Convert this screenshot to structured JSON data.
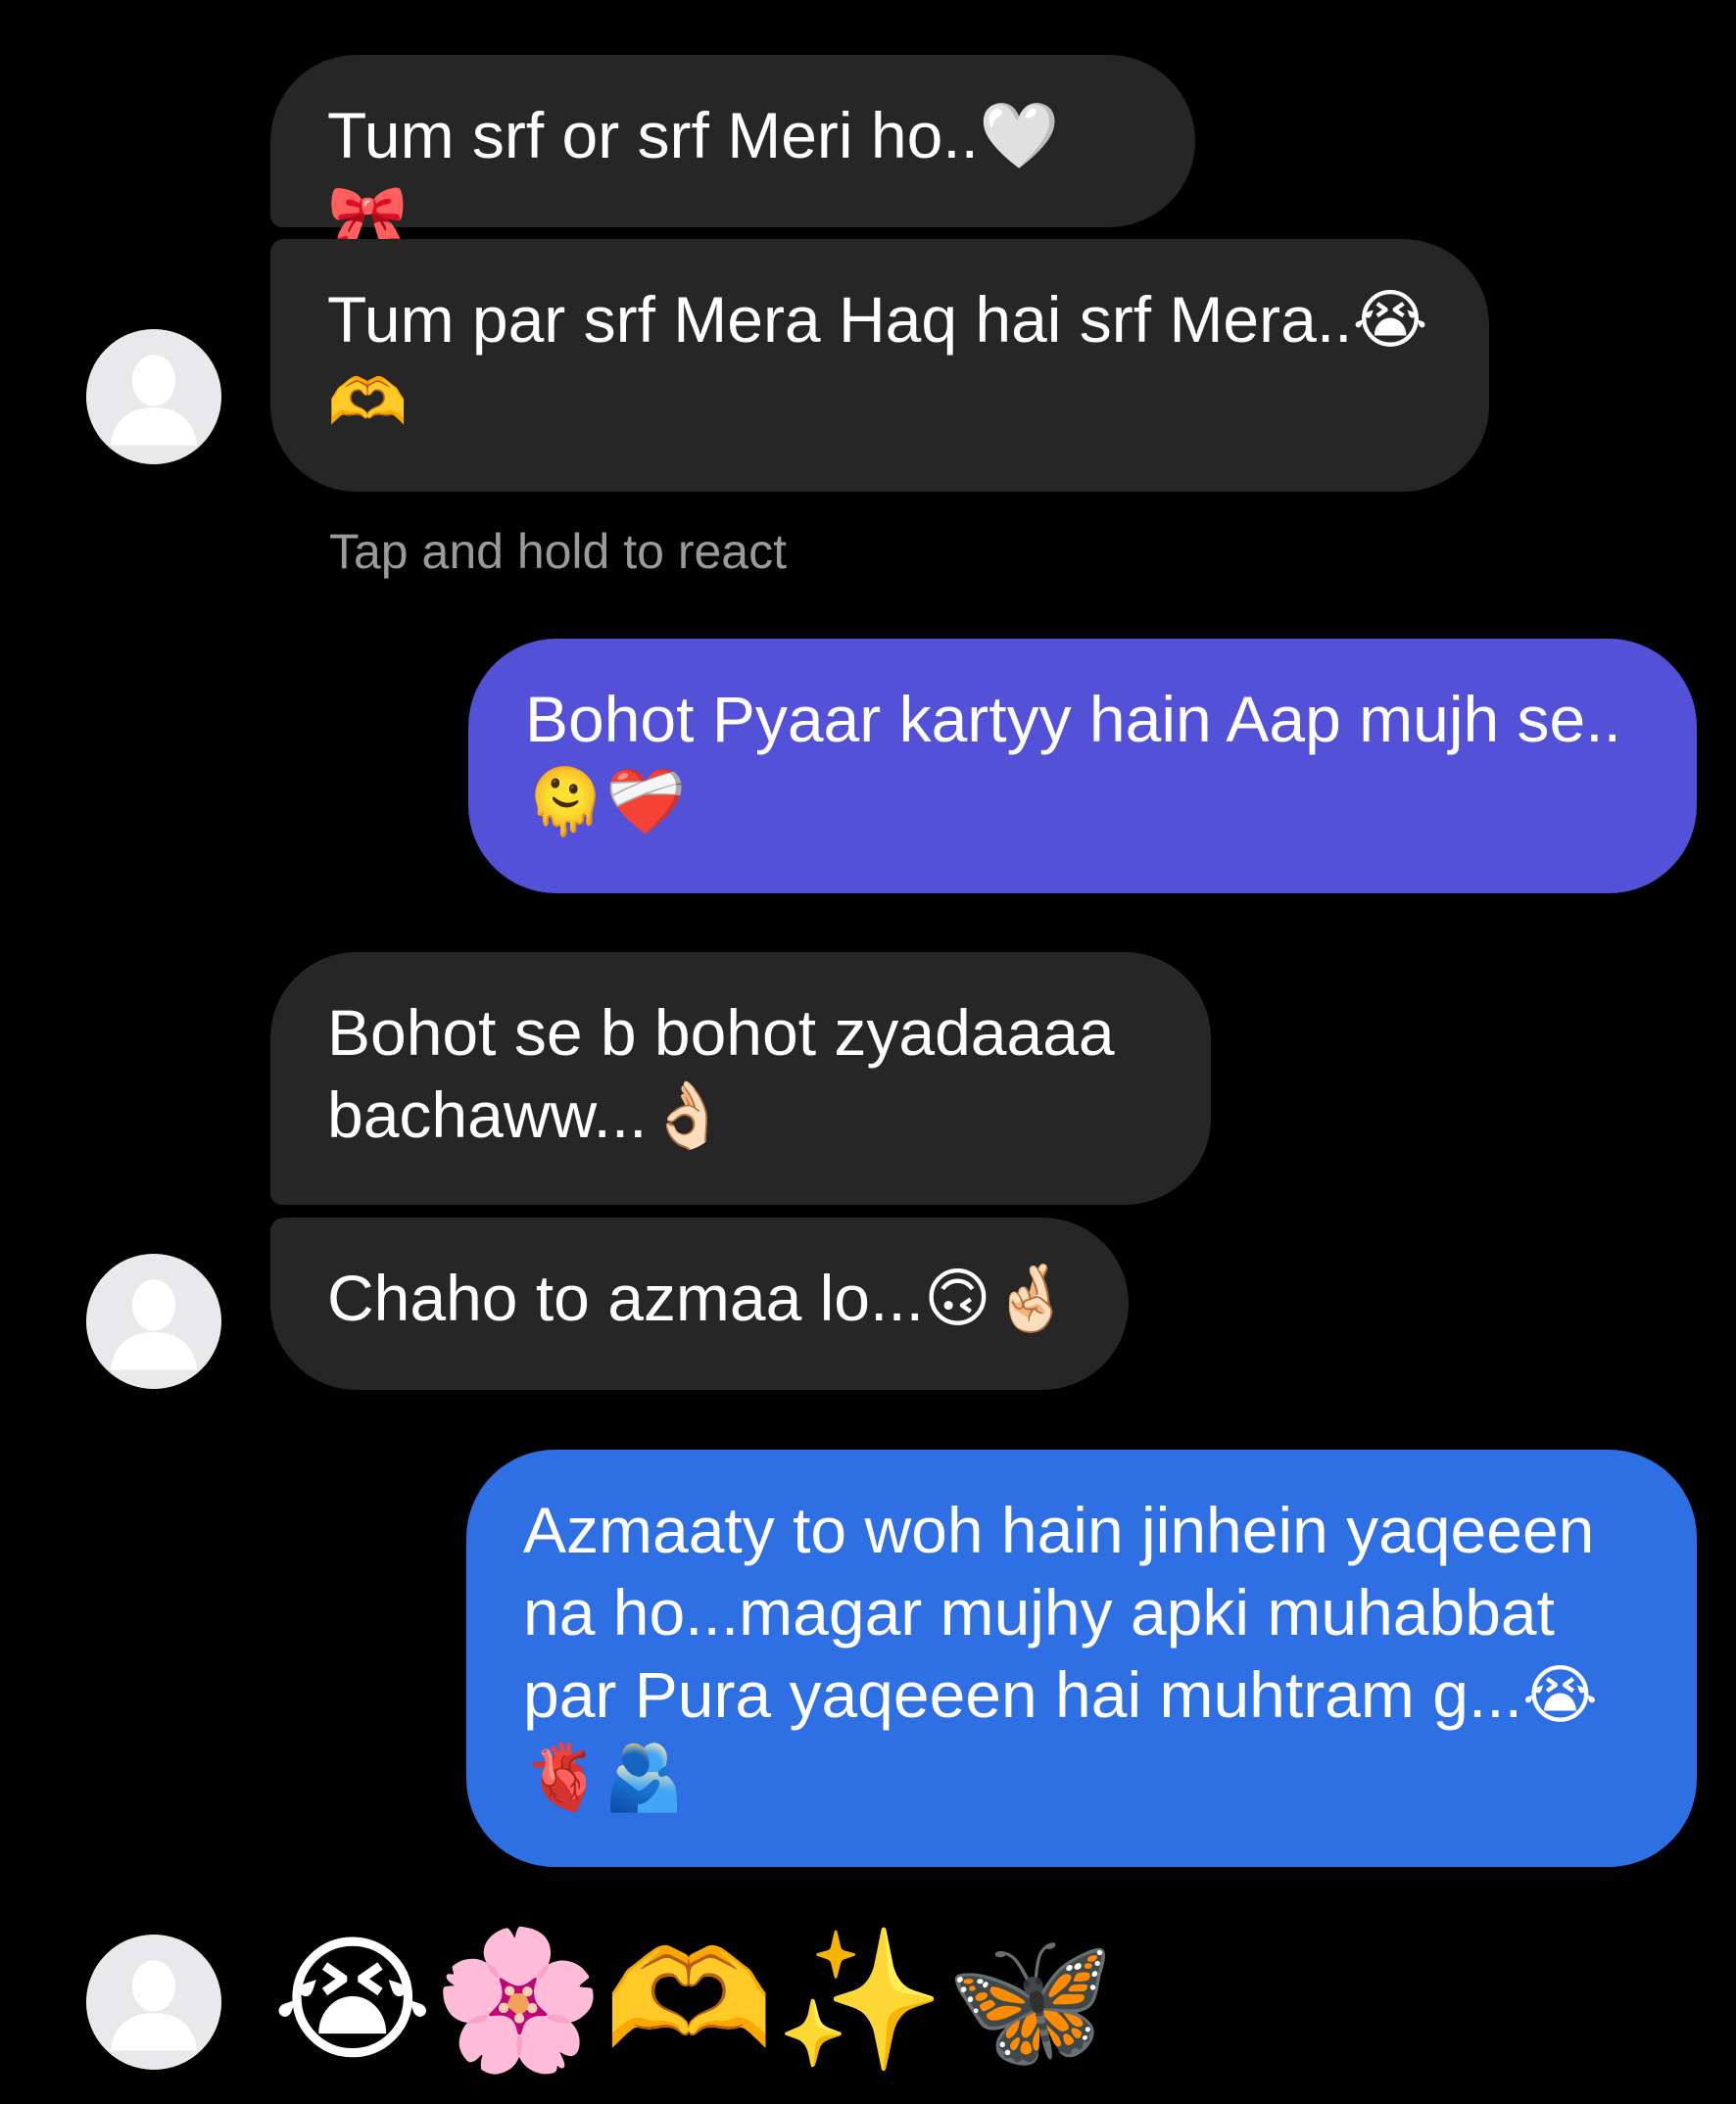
{
  "messages": [
    {
      "text": "Tum srf or srf Meri ho..🤍🎀"
    },
    {
      "text": "Tum par srf Mera Haq hai srf Mera..😭🫶"
    },
    {
      "text": "Bohot Pyaar kartyy hain Aap mujh se..🫠❤️‍🩹"
    },
    {
      "text": "Bohot se b bohot zyadaaaa bachaww...👌🏻"
    },
    {
      "text": "Chaho to azmaa lo...🙃🤞🏻"
    },
    {
      "text": "Azmaaty to woh hain jinhein yaqeeen na ho...magar mujhy apki muhabbat par Pura yaqeeen hai muhtram g...😭🫀🫂"
    },
    {
      "text": "😭🌸🫶✨🦋"
    }
  ],
  "hint": "Tap and hold to react",
  "colors": {
    "background": "#000000",
    "incoming_bubble": "#262626",
    "outgoing_bubble_purple": "#5451d9",
    "outgoing_bubble_blue": "#2f6fe4",
    "hint_text": "#9a9a9a",
    "avatar": "#e9e9ec"
  },
  "icons": {
    "avatar": "default-user-avatar-icon"
  }
}
